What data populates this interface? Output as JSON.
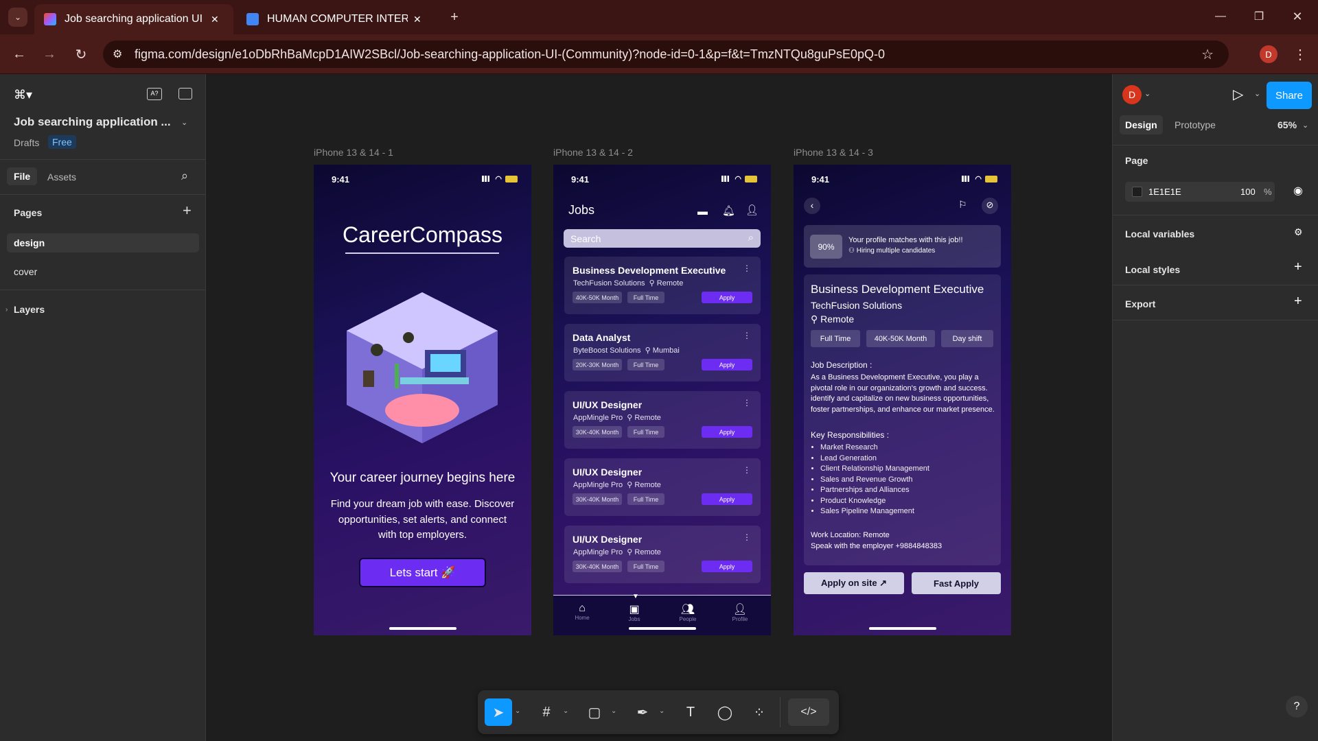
{
  "browser": {
    "tabs": [
      {
        "title": "Job searching application UI (Co",
        "active": true
      },
      {
        "title": "HUMAN COMPUTER INTERACTI",
        "active": false
      }
    ],
    "url": "figma.com/design/e1oDbRhBaMcpD1AIW2SBcl/Job-searching-application-UI-(Community)?node-id=0-1&p=f&t=TmzNTQu8guPsE0pQ-0",
    "profile_initial": "D"
  },
  "left": {
    "file_name": "Job searching application ...",
    "drafts": "Drafts",
    "plan_badge": "Free",
    "tab_file": "File",
    "tab_assets": "Assets",
    "pages_heading": "Pages",
    "pages": [
      "design",
      "cover"
    ],
    "layers_heading": "Layers"
  },
  "right": {
    "avatar": "D",
    "share": "Share",
    "tab_design": "Design",
    "tab_prototype": "Prototype",
    "zoom": "65%",
    "page_heading": "Page",
    "bg_hex": "1E1E1E",
    "bg_opacity": "100",
    "pct": "%",
    "local_variables": "Local variables",
    "local_styles": "Local styles",
    "export": "Export",
    "help": "?"
  },
  "frames": {
    "f1_label": "iPhone 13 & 14 - 1",
    "f2_label": "iPhone 13 & 14 - 2",
    "f3_label": "iPhone 13 & 14 - 3",
    "time": "9:41"
  },
  "screen1": {
    "brand": "CareerCompass",
    "headline": "Your career journey begins here",
    "body": "Find your dream job with ease. Discover opportunities, set alerts, and connect with top employers.",
    "cta": "Lets start 🚀"
  },
  "screen2": {
    "title": "Jobs",
    "search_placeholder": "Search",
    "jobs": [
      {
        "title": "Business Development Executive",
        "company": "TechFusion Solutions",
        "location": "Remote",
        "salary": "40K-50K Month",
        "type": "Full Time",
        "apply": "Apply"
      },
      {
        "title": "Data Analyst",
        "company": "ByteBoost Solutions",
        "location": "Mumbai",
        "salary": "20K-30K Month",
        "type": "Full Time",
        "apply": "Apply"
      },
      {
        "title": "UI/UX Designer",
        "company": "AppMingle Pro",
        "location": "Remote",
        "salary": "30K-40K Month",
        "type": "Full Time",
        "apply": "Apply"
      },
      {
        "title": "UI/UX Designer",
        "company": "AppMingle Pro",
        "location": "Remote",
        "salary": "30K-40K Month",
        "type": "Full Time",
        "apply": "Apply"
      },
      {
        "title": "UI/UX Designer",
        "company": "AppMingle Pro",
        "location": "Remote",
        "salary": "30K-40K Month",
        "type": "Full Time",
        "apply": "Apply"
      }
    ],
    "nav": [
      "Home",
      "Jobs",
      "People",
      "Profile"
    ]
  },
  "screen3": {
    "match_pct": "90%",
    "match_text": "Your profile matches with this job!!",
    "hiring_text": "Hiring multiple candidates",
    "job_title": "Business Development Executive",
    "company": "TechFusion Solutions",
    "location": "Remote",
    "tag1": "Full Time",
    "tag2": "40K-50K Month",
    "tag3": "Day shift",
    "desc_heading": "Job Description :",
    "desc": "As a Business Development Executive, you play a pivotal role in our organization's growth and success.  identify and capitalize on new business opportunities, foster partnerships, and enhance our market presence.",
    "resp_heading": "Key Responsibilities :",
    "responsibilities": [
      "Market Research",
      "Lead Generation",
      "Client Relationship Management",
      "Sales and Revenue Growth",
      "Partnerships and Alliances",
      "Product Knowledge",
      "Sales Pipeline Management"
    ],
    "work_location": "Work Location: Remote",
    "contact": "Speak with the employer +9884848383",
    "apply_site": "Apply on site ↗",
    "fast_apply": "Fast Apply"
  },
  "colors": {
    "accent": "#0d99ff",
    "purple": "#6c2cf2",
    "chrome": "#3b1513"
  }
}
